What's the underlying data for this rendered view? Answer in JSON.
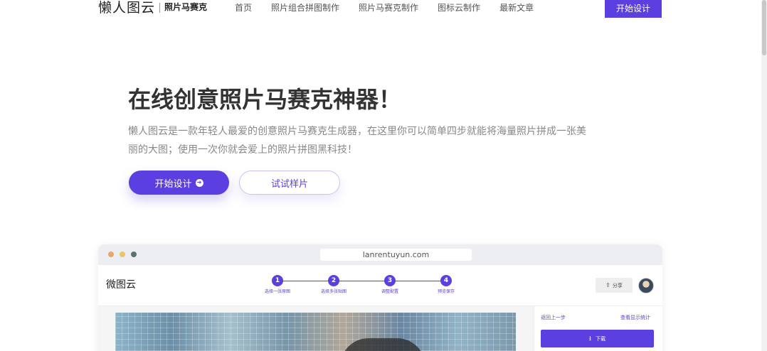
{
  "header": {
    "brand": "懒人图云",
    "brand_sub": "照片马赛克",
    "nav": [
      "首页",
      "照片组合拼图制作",
      "照片马赛克制作",
      "图标云制作",
      "最新文章"
    ],
    "cta": "开始设计"
  },
  "hero": {
    "title": "在线创意照片马赛克神器！",
    "description": "懒人图云是一款年轻人最爱的创意照片马赛克生成器，在这里你可以简单四步就能将海量照片拼成一张美丽的大图；使用一次你就会爱上的照片拼图黑科技！",
    "start_button": "开始设计",
    "sample_button": "试试样片"
  },
  "mockup": {
    "url": "lanrentuyun.com",
    "app_title": "微图云",
    "steps": [
      {
        "num": "1",
        "label": "选择一张原图"
      },
      {
        "num": "2",
        "label": "选择多张贴图"
      },
      {
        "num": "3",
        "label": "调整配置"
      },
      {
        "num": "4",
        "label": "预览保存"
      }
    ],
    "share": "分享",
    "back_link": "返回上一步",
    "stats_link": "查看显示统计",
    "download": "下载"
  },
  "colors": {
    "accent": "#5b3fe0",
    "text_dark": "#333333",
    "text_muted": "#888888"
  },
  "icons": {
    "start_arrow": "arrow-right-circle-icon",
    "share": "share-icon",
    "download": "download-icon"
  }
}
